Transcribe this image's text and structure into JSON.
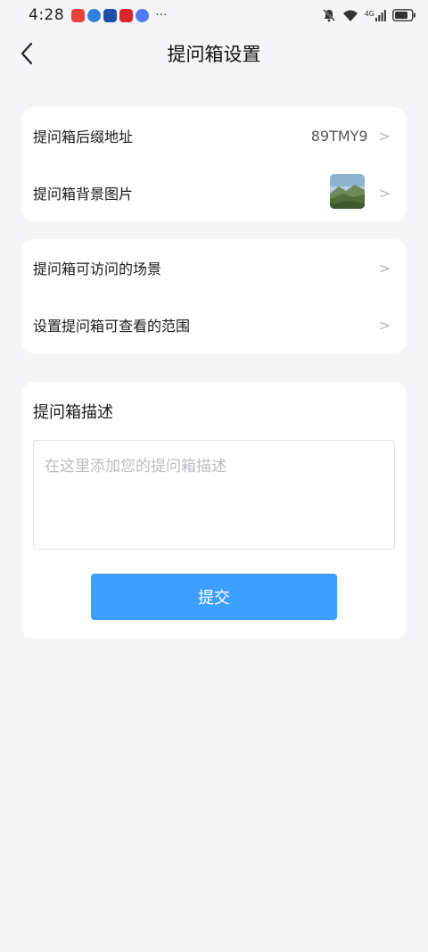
{
  "status_bar": {
    "time": "4:28",
    "more": "···",
    "network": "4G",
    "app_icons": [
      {
        "name": "red-app-icon",
        "color": "#e8443a"
      },
      {
        "name": "blue-app-icon",
        "color": "#2f7fe0"
      },
      {
        "name": "dark-blue-app-icon",
        "color": "#1f4fa8"
      },
      {
        "name": "red-app-icon-2",
        "color": "#d8262e"
      },
      {
        "name": "music-app-icon",
        "color": "#4f7cf0"
      }
    ]
  },
  "nav": {
    "back_icon": "chevron-left-icon",
    "title": "提问箱设置"
  },
  "settings_group_1": {
    "suffix_row": {
      "label": "提问箱后缀地址",
      "value": "89TMY9",
      "chevron": ">"
    },
    "background_row": {
      "label": "提问箱背景图片",
      "chevron": ">"
    }
  },
  "settings_group_2": {
    "scenes_row": {
      "label": "提问箱可访问的场景",
      "chevron": ">"
    },
    "range_row": {
      "label": "设置提问箱可查看的范围",
      "chevron": ">"
    }
  },
  "description": {
    "title": "提问箱描述",
    "value": "",
    "placeholder": "在这里添加您的提问箱描述",
    "submit_label": "提交"
  },
  "colors": {
    "accent": "#3d9fff",
    "background": "#f5f5f7",
    "card": "#ffffff"
  }
}
